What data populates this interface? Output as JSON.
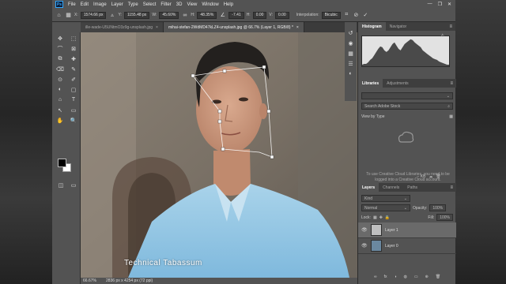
{
  "app": {
    "logo": "Ps"
  },
  "menu": [
    "File",
    "Edit",
    "Image",
    "Layer",
    "Type",
    "Select",
    "Filter",
    "3D",
    "View",
    "Window",
    "Help"
  ],
  "window_controls": [
    "—",
    "❐",
    "✕"
  ],
  "options": {
    "x_label": "X:",
    "x_value": "1574.66 px",
    "y_label": "Y:",
    "y_value": "1155.48 px",
    "w_label": "W:",
    "w_value": "45.60%",
    "h_label": "H:",
    "h_value": "48.35%",
    "angle_value": "-7.41",
    "h_skew_label": "H:",
    "h_skew_value": "0.00",
    "v_skew_label": "V:",
    "v_skew_value": "0.00",
    "interp_label": "Interpolation:",
    "interp_value": "Bicubic"
  },
  "doc_tabs": [
    {
      "label": "ille-wade-U5UNtmO3z9g-unsplash.jpg",
      "close": "×"
    },
    {
      "label": "mihai-stefan-2WdMD47kLZ4-unsplash.jpg @ 66.7% (Layer 1, RGB/8) *",
      "close": "×"
    }
  ],
  "tools": [
    "✥",
    "⬚",
    "⌒",
    "⊠",
    "⧉",
    "✚",
    "⌫",
    "✎",
    "⊙",
    "✐",
    "◐",
    "▢",
    "⌂",
    "T",
    "↖",
    "▭",
    "✋",
    "🔍"
  ],
  "status": {
    "zoom": "66.67%",
    "doc": "2836 px x 4254 px (72 ppi)"
  },
  "panels": {
    "top_tabs": [
      "Histogram",
      "Navigator"
    ],
    "histogram": {
      "color_light": "#e2e2e2",
      "color_dark": "#4a4a4a",
      "series": [
        2,
        3,
        3,
        5,
        8,
        10,
        14,
        18,
        22,
        25,
        24,
        20,
        18,
        20,
        24,
        28,
        30,
        26,
        22,
        20,
        24,
        28,
        30,
        32,
        34,
        33,
        30,
        28,
        26,
        24,
        20,
        18,
        16,
        14,
        12,
        10,
        9,
        8,
        6,
        5,
        4,
        3,
        2,
        2
      ]
    },
    "library_tabs": [
      "Libraries",
      "Adjustments"
    ],
    "search_placeholder": "Search Adobe Stock",
    "view_by": "View by Type",
    "library_message": "To use Creative Cloud Libraries, you need to be logged into a Creative Cloud account.",
    "library_size": "-- KB",
    "layers_tabs": [
      "Layers",
      "Channels",
      "Paths"
    ],
    "kind_label": "Kind",
    "blend_mode": "Normal",
    "opacity_label": "Opacity:",
    "opacity_value": "100%",
    "lock_label": "Lock:",
    "fill_label": "Fill:",
    "fill_value": "100%",
    "layers": [
      {
        "name": "Layer 1",
        "selected": true
      },
      {
        "name": "Layer 0",
        "selected": false
      }
    ],
    "bottom_buttons": [
      "∞",
      "fx",
      "◑",
      "◍",
      "▭",
      "⊕",
      "🗑"
    ]
  },
  "watermark": "Technical Tabassum"
}
